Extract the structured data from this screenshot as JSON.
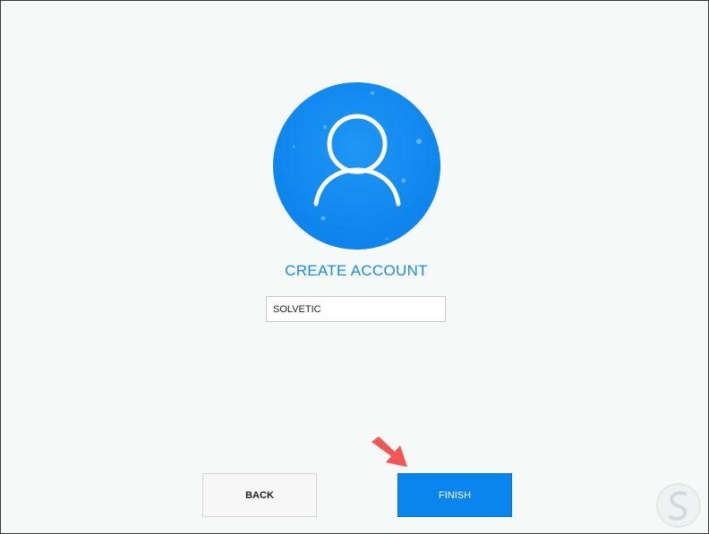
{
  "heading": "CREATE ACCOUNT",
  "account_name": {
    "value": "SOLVETIC"
  },
  "buttons": {
    "back": "BACK",
    "finish": "FINISH"
  },
  "icons": {
    "avatar": "user-icon",
    "pointer": "arrow-icon",
    "watermark": "solvetic-logo"
  },
  "colors": {
    "accent": "#0b85ee",
    "heading": "#1b8ae8",
    "arrow": "#f05656"
  }
}
